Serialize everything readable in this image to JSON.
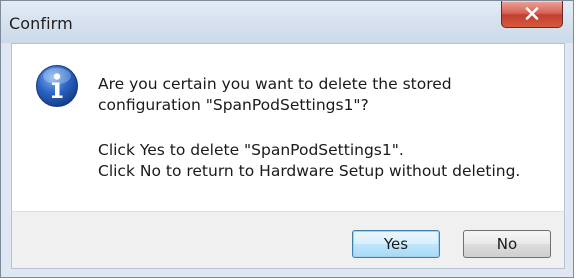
{
  "window": {
    "title": "Confirm",
    "close_label": "close"
  },
  "message": {
    "line1": "Are you certain you want to delete the stored",
    "line2": "configuration \"SpanPodSettings1\"?",
    "line3": "Click Yes to delete \"SpanPodSettings1\".",
    "line4": "Click No to return to Hardware Setup without deleting."
  },
  "icon": {
    "name": "information-icon",
    "color": "#2a63c4"
  },
  "buttons": {
    "yes_label": "Yes",
    "no_label": "No"
  }
}
